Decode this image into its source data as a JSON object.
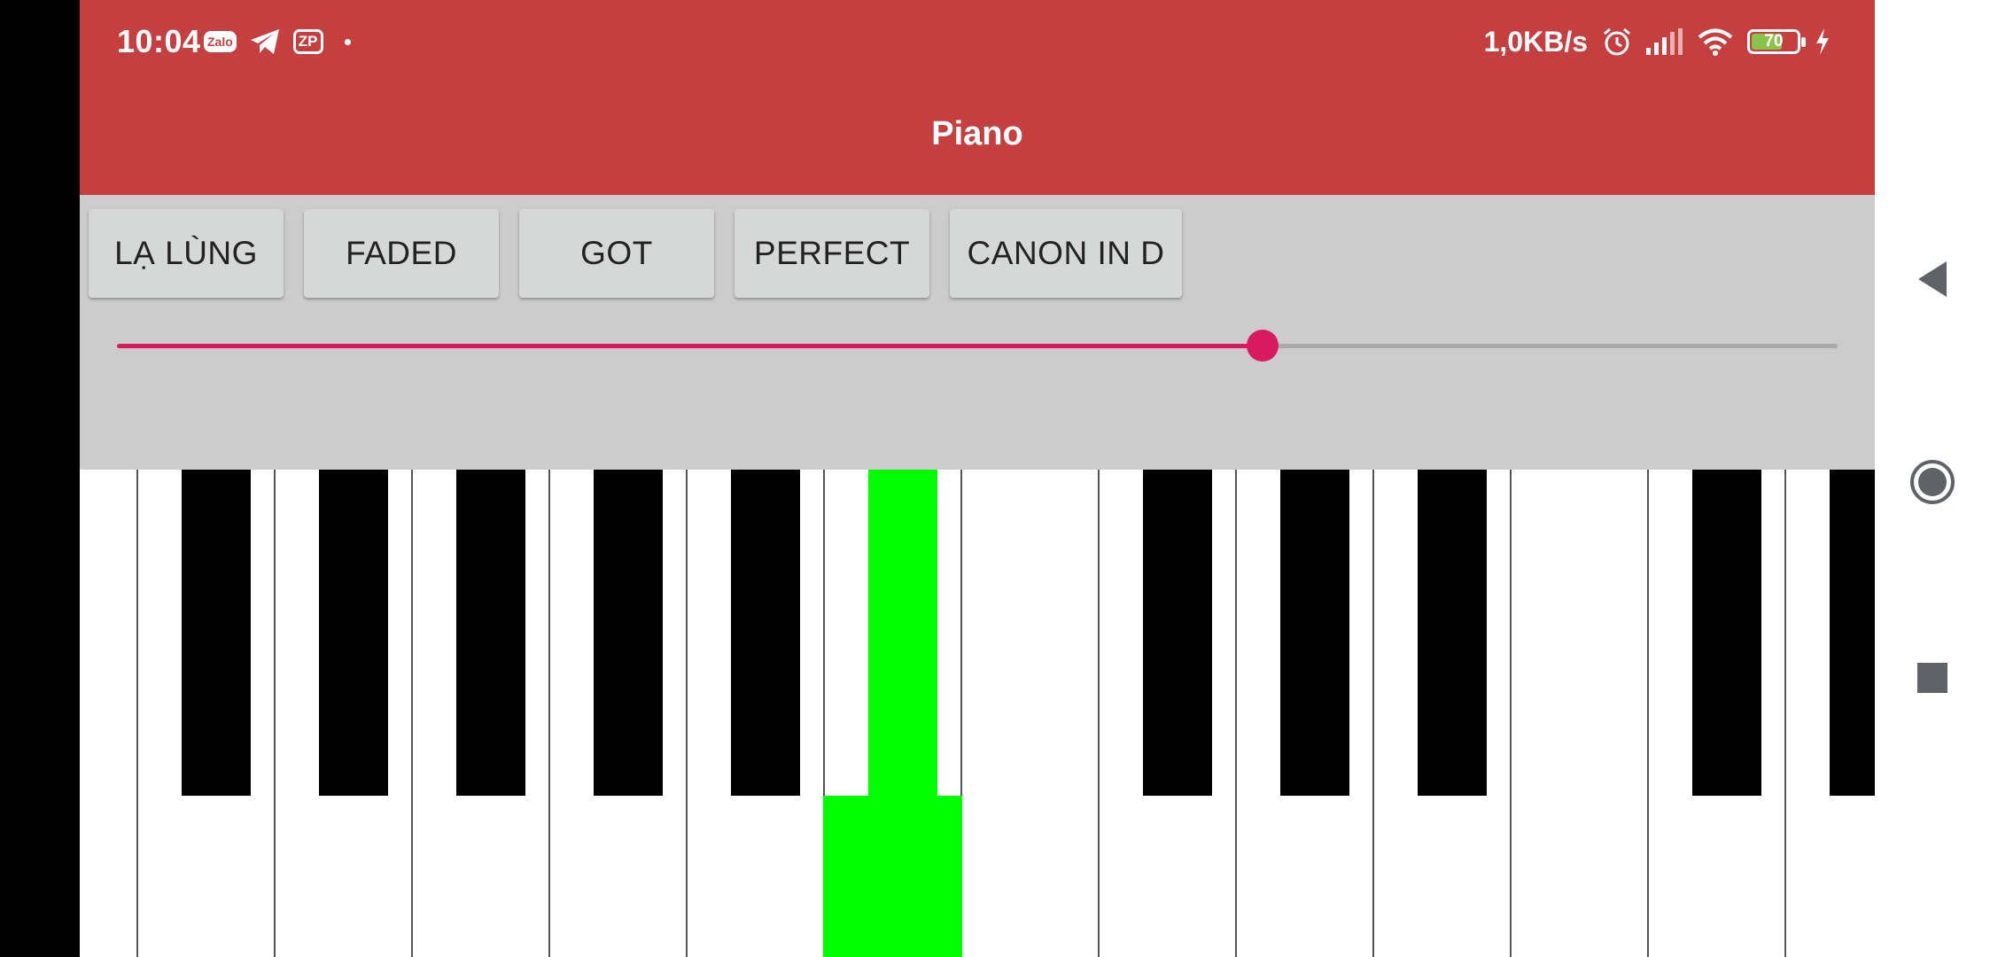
{
  "status_bar": {
    "time": "10:04",
    "zalo_label": "Zalo",
    "zp_label": "ZP",
    "network_speed": "1,0KB/s",
    "battery_level": "70",
    "battery_fraction": 0.7
  },
  "app": {
    "title": "Piano",
    "accent_color": "#c53f41"
  },
  "song_buttons": [
    {
      "label": "LẠ LÙNG"
    },
    {
      "label": "FADED"
    },
    {
      "label": "GOT"
    },
    {
      "label": "PERFECT"
    },
    {
      "label": "CANON IN D"
    }
  ],
  "slider": {
    "value_fraction": 0.666,
    "color": "#d81b60"
  },
  "keyboard": {
    "white_key_count": 14,
    "black_key_count": 11,
    "active_key": "black-key-5",
    "active_color": "#00ff00"
  },
  "nav": {
    "back": "back-icon",
    "home": "home-icon",
    "recents": "recents-icon"
  }
}
